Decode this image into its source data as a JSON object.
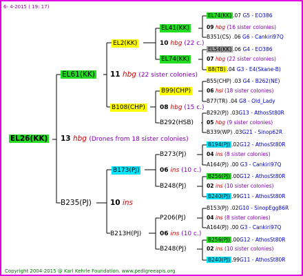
{
  "header_date": "6- 4-2015 ( 19: 17)",
  "footer": "Copyright 2004-2015 @ Karl Kehrle Foundation.   www.pedigreeapis.org",
  "root": {
    "id": "EL26(KK)",
    "hbg_num": "13",
    "hbg": "hbg",
    "note": "(Drones from 18 sister colonies)"
  },
  "gen1": {
    "top": {
      "id": "EL61(KK)",
      "hbg_num": "11",
      "hbg": "hbg",
      "note": "(22 sister colonies)"
    },
    "bottom": {
      "id": "B235(PJ)",
      "num": "10",
      "ins": "ins"
    }
  },
  "gen2": {
    "a": {
      "id": "EL2(KK)",
      "num": "10",
      "hbg": "hbg",
      "note": "(22 c.)"
    },
    "b": {
      "id": "B108(CHP)",
      "num": "08",
      "hbg": "hbg",
      "note": "(15 c.)"
    },
    "c": {
      "id": "B173(PJ)",
      "num": "06",
      "ins": "ins",
      "note": "(10 c.)"
    },
    "d": {
      "id": "B213H(PJ)",
      "num": "06",
      "ins": "ins",
      "note": "(10 c.)"
    }
  },
  "gen3": {
    "a1": {
      "id": "EL41(KK)",
      "num": "09",
      "ins": "hbg",
      "note": "(16 sister colonies)"
    },
    "a2": {
      "id": "EL74(KK)",
      "num": "07",
      "ins": "hbg",
      "note": "(22 sister colonies)"
    },
    "b1": {
      "id": "B99(CHP)",
      "num": "06",
      "ins": "hsl",
      "note": "(18 sister colonies)"
    },
    "b2": {
      "id": "B292(HSB)",
      "num": "05",
      "ins": "hbg",
      "note": "(9 sister colonies)"
    },
    "c1": {
      "id": "B273(PJ)",
      "num": "04",
      "ins": "ins",
      "note": "(8 sister colonies)"
    },
    "c2": {
      "id": "B248(PJ)",
      "num": "02",
      "ins": "ins",
      "note": "(10 sister colonies)"
    },
    "d1": {
      "id": "P206(PJ)",
      "num": "04",
      "ins": "ins",
      "note": "(8 sister colonies)"
    },
    "d2": {
      "id": "B248(PJ)",
      "num": "02",
      "ins": "ins",
      "note": "(10 sister colonies)"
    }
  },
  "gen4": [
    {
      "id": "EL74(KK)",
      "num": ".07",
      "desc": "G5 - EO386"
    },
    {
      "id": "B351(CS)",
      "num": ".06",
      "desc": "G6 - Cankiri97Q"
    },
    {
      "id": "EL54(KK)",
      "num": ".06",
      "desc": "G4 - EO386"
    },
    {
      "id": "B8(TB)",
      "num": ".04",
      "desc": "G3 - E4(Skane-B)"
    },
    {
      "id": "B55(CHP)",
      "num": ".03",
      "desc": "G4 - B262(NE)"
    },
    {
      "id": "B77(TR)",
      "num": ".04",
      "desc": "G8 - Old_Lady"
    },
    {
      "id": "B292(PJ)",
      "num": ".03",
      "desc": "G13 - AthosSt80R"
    },
    {
      "id": "B339(WP)",
      "num": ".03",
      "desc": "G21 - Sinop62R"
    },
    {
      "id": "B194(PJ)",
      "num": ".02",
      "desc": "G12 - AthosSt80R"
    },
    {
      "id": "A164(PJ)",
      "num": ".00",
      "desc": "G3 - Cankiri97Q"
    },
    {
      "id": "B256(PJ)",
      "num": ".00",
      "desc": "G12 - AthosSt80R"
    },
    {
      "id": "B240(PJ)",
      "num": ".99",
      "desc": "G11 - AthosSt80R"
    },
    {
      "id": "B153(PJ)",
      "num": ".02",
      "desc": "G10 - SinopEgg86R"
    },
    {
      "id": "A164(PJ)",
      "num": ".00",
      "desc": "G3 - Cankiri97Q"
    },
    {
      "id": "B256(PJ)",
      "num": ".00",
      "desc": "G12 - AthosSt80R"
    },
    {
      "id": "B240(PJ)",
      "num": ".99",
      "desc": "G11 - AthosSt80R"
    }
  ]
}
